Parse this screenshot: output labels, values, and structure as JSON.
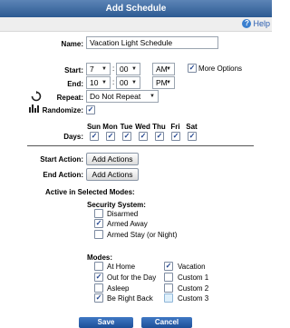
{
  "dialog": {
    "title": "Add Schedule",
    "help_label": "Help"
  },
  "form": {
    "name_label": "Name:",
    "name_value": "Vacation Light Schedule",
    "start_label": "Start:",
    "start_hour": "7",
    "start_minute": "00",
    "start_ampm": "AM",
    "more_options_label": "More Options",
    "more_options_checked": true,
    "end_label": "End:",
    "end_hour": "10",
    "end_minute": "00",
    "end_ampm": "PM",
    "repeat_label": "Repeat:",
    "repeat_value": "Do Not Repeat",
    "randomize_label": "Randomize:",
    "randomize_checked": true,
    "days_label": "Days:",
    "days": [
      {
        "label": "Sun",
        "checked": true
      },
      {
        "label": "Mon",
        "checked": true
      },
      {
        "label": "Tue",
        "checked": true
      },
      {
        "label": "Wed",
        "checked": true
      },
      {
        "label": "Thu",
        "checked": true
      },
      {
        "label": "Fri",
        "checked": true
      },
      {
        "label": "Sat",
        "checked": true
      }
    ],
    "start_action_label": "Start Action:",
    "end_action_label": "End Action:",
    "add_actions_label": "Add Actions",
    "active_modes_label": "Active in Selected Modes:",
    "security_label": "Security System:",
    "security_options": [
      {
        "label": "Disarmed",
        "checked": false
      },
      {
        "label": "Armed Away",
        "checked": true
      },
      {
        "label": "Armed Stay (or Night)",
        "checked": false
      }
    ],
    "modes_label": "Modes:",
    "modes_left": [
      {
        "label": "At Home",
        "checked": false
      },
      {
        "label": "Out for the Day",
        "checked": true
      },
      {
        "label": "Asleep",
        "checked": false
      },
      {
        "label": "Be Right Back",
        "checked": true
      }
    ],
    "modes_right": [
      {
        "label": "Vacation",
        "checked": true
      },
      {
        "label": "Custom 1",
        "checked": false
      },
      {
        "label": "Custom 2",
        "checked": false
      },
      {
        "label": "Custom 3",
        "checked": false
      }
    ]
  },
  "buttons": {
    "save_label": "Save",
    "cancel_label": "Cancel"
  },
  "colors": {
    "titlebar": "#2c5a92",
    "button_blue": "#1d4f98",
    "link": "#2a5db0"
  },
  "icons": {
    "help": "help-icon",
    "repeat": "repeat-icon",
    "randomize": "randomize-icon",
    "dropdown": "chevron-down-icon"
  }
}
